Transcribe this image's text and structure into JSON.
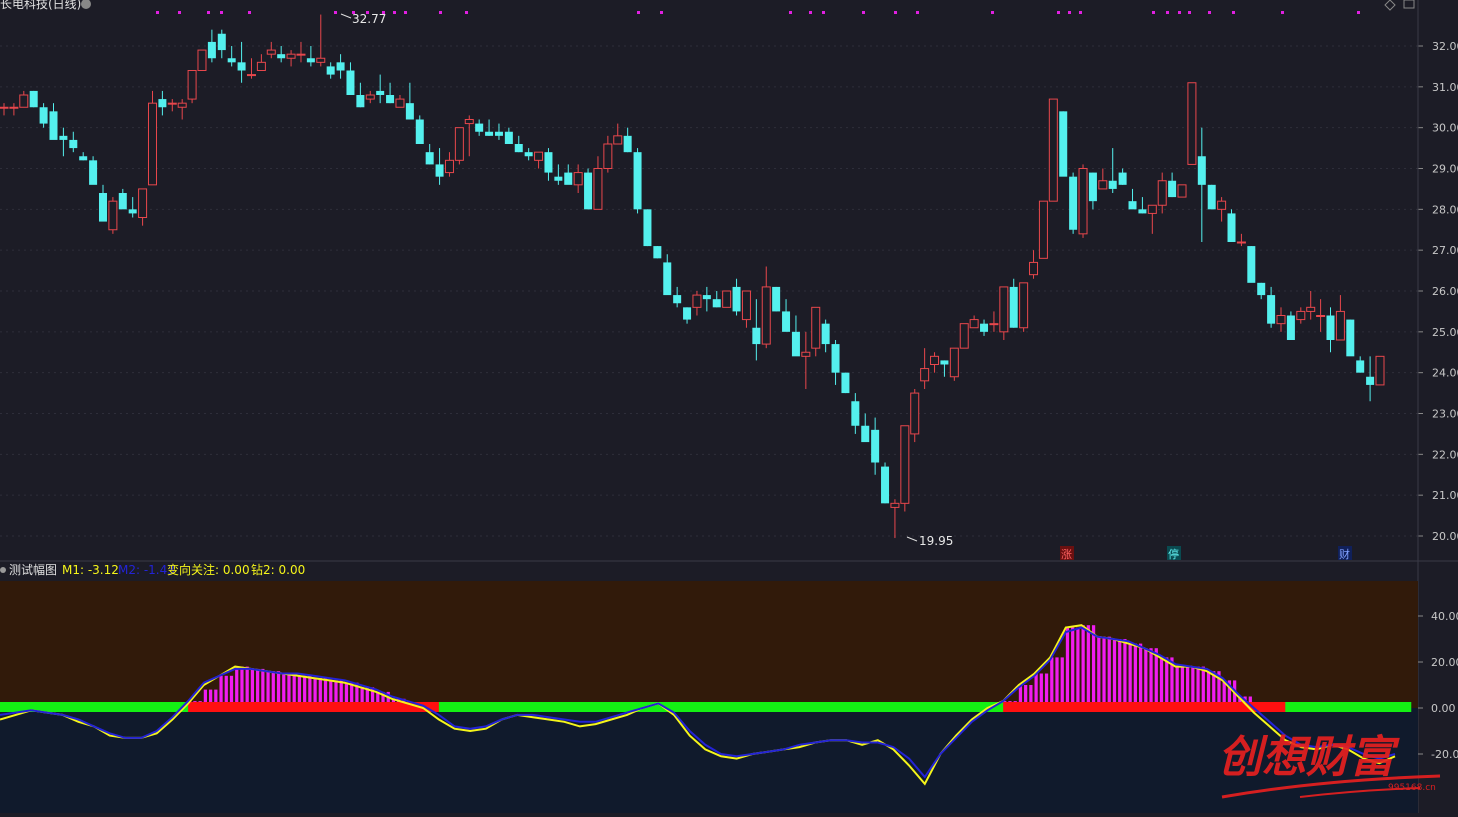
{
  "header": {
    "stock_title": "长电科技(日线)",
    "settings_glyph": "⚙",
    "corner_icon": "diamond-icon"
  },
  "indicator_header": {
    "title": "测试幅图",
    "m1_label": "M1: -3.12",
    "m2_label": "M2: -1.43",
    "watch_label": "变向关注: 0.00",
    "drill_label": "钻2: 0.00"
  },
  "annotations": {
    "high_label": "32.77",
    "low_label": "19.95",
    "tags": [
      "涨",
      "停",
      "财"
    ]
  },
  "watermark": {
    "text": "创想财富",
    "url": "995168.cn"
  },
  "colors": {
    "background": "#1c1c26",
    "up_candle": "#e8474c",
    "down_candle": "#54f0ee",
    "m1_line": "#f5f51a",
    "m2_line": "#2323d6",
    "hist_bar": "#f01cf0",
    "green_band": "#14f014",
    "red_band": "#ff1010",
    "upper_zone": "#311a0a",
    "lower_zone": "#101a2c",
    "axis_text": "#c8c8c8",
    "watermark": "#e62020"
  },
  "chart_data": [
    {
      "type": "candlestick",
      "y_ticks": [
        "32.00",
        "31.00",
        "30.00",
        "29.00",
        "28.00",
        "27.00",
        "26.00",
        "25.00",
        "24.00",
        "23.00",
        "22.00",
        "21.00",
        "20.00"
      ],
      "ylim": [
        19.6,
        32.9
      ],
      "grid": true,
      "highest": 32.77,
      "lowest": 19.95,
      "ohlc": [
        [
          30.5,
          30.6,
          30.3,
          30.5
        ],
        [
          30.5,
          30.6,
          30.3,
          30.5
        ],
        [
          30.5,
          30.9,
          30.5,
          30.8
        ],
        [
          30.9,
          30.9,
          30.5,
          30.5
        ],
        [
          30.5,
          30.6,
          30.0,
          30.1
        ],
        [
          30.4,
          30.6,
          29.8,
          29.7
        ],
        [
          29.8,
          30.0,
          29.3,
          29.7
        ],
        [
          29.7,
          29.9,
          29.4,
          29.5
        ],
        [
          29.3,
          29.4,
          29.2,
          29.2
        ],
        [
          29.2,
          29.3,
          28.7,
          28.6
        ],
        [
          28.4,
          28.6,
          28.0,
          27.7
        ],
        [
          27.5,
          28.3,
          27.4,
          28.2
        ],
        [
          28.4,
          28.5,
          28.2,
          28.0
        ],
        [
          28.0,
          28.3,
          27.8,
          27.9
        ],
        [
          27.8,
          28.5,
          27.6,
          28.5
        ],
        [
          28.6,
          30.9,
          28.6,
          30.6
        ],
        [
          30.7,
          30.9,
          30.3,
          30.5
        ],
        [
          30.6,
          30.7,
          30.4,
          30.6
        ],
        [
          30.5,
          30.7,
          30.2,
          30.6
        ],
        [
          30.7,
          31.4,
          30.6,
          31.4
        ],
        [
          31.4,
          31.9,
          31.4,
          31.9
        ],
        [
          32.1,
          32.4,
          31.6,
          31.7
        ],
        [
          32.3,
          32.4,
          31.7,
          31.9
        ],
        [
          31.7,
          32.0,
          31.5,
          31.6
        ],
        [
          31.6,
          32.1,
          31.1,
          31.4
        ],
        [
          31.3,
          31.7,
          31.2,
          31.3
        ],
        [
          31.4,
          31.8,
          31.4,
          31.6
        ],
        [
          31.8,
          32.1,
          31.7,
          31.9
        ],
        [
          31.8,
          32.0,
          31.6,
          31.7
        ],
        [
          31.7,
          31.9,
          31.5,
          31.8
        ],
        [
          31.8,
          32.1,
          31.6,
          31.8
        ],
        [
          31.7,
          32.0,
          31.5,
          31.6
        ],
        [
          31.6,
          32.77,
          31.5,
          31.7
        ],
        [
          31.5,
          31.6,
          31.2,
          31.3
        ],
        [
          31.6,
          31.8,
          31.2,
          31.4
        ],
        [
          31.4,
          31.6,
          30.8,
          30.8
        ],
        [
          30.8,
          31.1,
          30.5,
          30.5
        ],
        [
          30.7,
          30.9,
          30.6,
          30.8
        ],
        [
          30.9,
          31.3,
          30.6,
          30.8
        ],
        [
          30.8,
          31.1,
          30.6,
          30.6
        ],
        [
          30.5,
          30.8,
          30.5,
          30.7
        ],
        [
          30.6,
          31.1,
          30.5,
          30.2
        ],
        [
          30.2,
          30.3,
          29.6,
          29.6
        ],
        [
          29.4,
          29.6,
          29.1,
          29.1
        ],
        [
          29.1,
          29.5,
          28.6,
          28.8
        ],
        [
          28.9,
          29.4,
          28.8,
          29.2
        ],
        [
          29.2,
          30.0,
          29.1,
          30.0
        ],
        [
          30.1,
          30.3,
          29.3,
          30.2
        ],
        [
          30.1,
          30.2,
          29.8,
          29.9
        ],
        [
          29.9,
          30.2,
          29.8,
          29.8
        ],
        [
          29.9,
          30.1,
          29.7,
          29.8
        ],
        [
          29.9,
          30.0,
          29.6,
          29.6
        ],
        [
          29.6,
          29.8,
          29.4,
          29.4
        ],
        [
          29.4,
          29.5,
          29.2,
          29.3
        ],
        [
          29.2,
          29.3,
          29.0,
          29.4
        ],
        [
          29.4,
          29.5,
          28.7,
          28.9
        ],
        [
          28.8,
          29.1,
          28.6,
          28.7
        ],
        [
          28.9,
          29.1,
          28.8,
          28.6
        ],
        [
          28.6,
          29.1,
          28.4,
          28.9
        ],
        [
          28.9,
          29.0,
          28.0,
          28.0
        ],
        [
          28.0,
          29.3,
          28.0,
          29.0
        ],
        [
          29.0,
          29.8,
          28.9,
          29.6
        ],
        [
          29.6,
          30.1,
          29.6,
          29.8
        ],
        [
          29.8,
          30.0,
          29.4,
          29.4
        ],
        [
          29.4,
          29.5,
          27.9,
          28.0
        ],
        [
          28.0,
          28.0,
          27.1,
          27.1
        ],
        [
          27.1,
          27.1,
          26.8,
          26.8
        ],
        [
          26.7,
          26.9,
          26.0,
          25.9
        ],
        [
          25.9,
          26.1,
          25.6,
          25.7
        ],
        [
          25.6,
          25.6,
          25.2,
          25.3
        ],
        [
          25.6,
          26.0,
          25.4,
          25.9
        ],
        [
          25.9,
          26.1,
          25.5,
          25.8
        ],
        [
          25.8,
          26.0,
          25.6,
          25.6
        ],
        [
          25.6,
          26.0,
          25.7,
          26.0
        ],
        [
          26.1,
          26.3,
          25.4,
          25.5
        ],
        [
          25.3,
          25.7,
          25.1,
          26.0
        ],
        [
          25.1,
          25.8,
          24.3,
          24.7
        ],
        [
          24.7,
          26.6,
          24.6,
          26.1
        ],
        [
          26.1,
          26.1,
          25.5,
          25.5
        ],
        [
          25.5,
          25.8,
          25.3,
          25.0
        ],
        [
          25.0,
          25.4,
          24.6,
          24.4
        ],
        [
          24.4,
          25.0,
          23.6,
          24.5
        ],
        [
          24.6,
          25.6,
          24.4,
          25.6
        ],
        [
          25.2,
          25.3,
          24.5,
          24.7
        ],
        [
          24.7,
          24.8,
          23.7,
          24.0
        ],
        [
          24.0,
          24.0,
          23.5,
          23.5
        ],
        [
          23.3,
          23.5,
          22.5,
          22.7
        ],
        [
          22.7,
          23.0,
          22.4,
          22.3
        ],
        [
          22.6,
          22.9,
          21.5,
          21.8
        ],
        [
          21.7,
          21.8,
          20.8,
          20.8
        ],
        [
          20.7,
          20.9,
          19.95,
          20.8
        ],
        [
          20.8,
          22.7,
          20.6,
          22.7
        ],
        [
          22.5,
          23.6,
          22.3,
          23.5
        ],
        [
          23.8,
          24.6,
          23.6,
          24.1
        ],
        [
          24.2,
          24.5,
          24.0,
          24.4
        ],
        [
          24.3,
          24.3,
          23.9,
          24.2
        ],
        [
          23.9,
          24.4,
          23.8,
          24.6
        ],
        [
          24.6,
          25.1,
          24.6,
          25.2
        ],
        [
          25.1,
          25.4,
          25.1,
          25.3
        ],
        [
          25.2,
          25.3,
          24.9,
          25.0
        ],
        [
          25.2,
          25.5,
          25.0,
          25.2
        ],
        [
          25.0,
          26.1,
          24.8,
          26.1
        ],
        [
          26.1,
          26.3,
          25.1,
          25.1
        ],
        [
          25.1,
          26.2,
          25.0,
          26.2
        ],
        [
          26.4,
          27.0,
          26.3,
          26.7
        ],
        [
          26.8,
          28.2,
          26.8,
          28.2
        ],
        [
          28.2,
          30.7,
          28.2,
          30.7
        ],
        [
          30.4,
          30.4,
          28.9,
          28.8
        ],
        [
          28.8,
          28.9,
          27.4,
          27.5
        ],
        [
          27.4,
          29.1,
          27.3,
          29.0
        ],
        [
          28.9,
          28.9,
          28.0,
          28.2
        ],
        [
          28.5,
          29.0,
          28.5,
          28.7
        ],
        [
          28.7,
          29.5,
          28.4,
          28.5
        ],
        [
          28.9,
          29.0,
          28.6,
          28.6
        ],
        [
          28.2,
          28.5,
          28.1,
          28.0
        ],
        [
          28.0,
          28.3,
          27.9,
          27.9
        ],
        [
          27.9,
          28.1,
          27.4,
          28.1
        ],
        [
          28.1,
          28.9,
          27.9,
          28.7
        ],
        [
          28.7,
          28.9,
          28.3,
          28.3
        ],
        [
          28.3,
          28.6,
          28.3,
          28.6
        ],
        [
          29.1,
          31.1,
          29.1,
          31.1
        ],
        [
          29.3,
          30.0,
          27.2,
          28.6
        ],
        [
          28.6,
          28.6,
          28.0,
          28.0
        ],
        [
          28.0,
          28.3,
          27.7,
          28.2
        ],
        [
          27.9,
          28.0,
          27.2,
          27.2
        ],
        [
          27.2,
          27.4,
          27.1,
          27.2
        ],
        [
          27.1,
          27.1,
          26.3,
          26.2
        ],
        [
          26.2,
          26.2,
          25.8,
          25.9
        ],
        [
          25.9,
          26.1,
          25.1,
          25.2
        ],
        [
          25.2,
          25.6,
          25.0,
          25.4
        ],
        [
          25.4,
          25.5,
          24.8,
          24.8
        ],
        [
          25.3,
          25.6,
          25.2,
          25.5
        ],
        [
          25.5,
          26.0,
          25.3,
          25.6
        ],
        [
          25.4,
          25.8,
          25.0,
          25.4
        ],
        [
          25.4,
          25.6,
          24.5,
          24.8
        ],
        [
          24.8,
          25.9,
          24.8,
          25.5
        ],
        [
          25.3,
          25.3,
          24.6,
          24.4
        ],
        [
          24.3,
          24.4,
          24.0,
          24.0
        ],
        [
          23.9,
          24.4,
          23.3,
          23.7
        ],
        [
          23.7,
          24.3,
          23.7,
          24.4
        ]
      ]
    },
    {
      "type": "line",
      "title": "测试幅图",
      "y_ticks": [
        "40.00",
        "20.00",
        "0.00",
        "-20.00"
      ],
      "ylim": [
        -45,
        55
      ],
      "grid": false,
      "series": [
        {
          "name": "M1",
          "values": [
            -5,
            -3,
            -1,
            -2,
            -3,
            -6,
            -8,
            -12,
            -13,
            -13,
            -11,
            -5,
            2,
            10,
            14,
            18,
            17,
            16,
            15,
            14,
            13,
            12,
            11,
            9,
            7,
            4,
            2,
            0,
            -5,
            -9,
            -10,
            -9,
            -5,
            -3,
            -4,
            -5,
            -6,
            -8,
            -7,
            -5,
            -3,
            0,
            2,
            -3,
            -12,
            -18,
            -21,
            -22,
            -20,
            -19,
            -18,
            -17,
            -15,
            -14,
            -14,
            -16,
            -14,
            -18,
            -25,
            -33,
            -20,
            -12,
            -5,
            0,
            3,
            10,
            15,
            22,
            35,
            36,
            31,
            30,
            28,
            26,
            22,
            18,
            18,
            16,
            12,
            5,
            -2,
            -8,
            -14,
            -17,
            -18,
            -16,
            -18,
            -22,
            -24,
            -21
          ]
        },
        {
          "name": "M2",
          "values": [
            -3,
            -2,
            -1,
            -2,
            -3,
            -5,
            -8,
            -11,
            -13,
            -13,
            -10,
            -4,
            3,
            11,
            14,
            17,
            17,
            16,
            15,
            15,
            14,
            13,
            12,
            10,
            8,
            5,
            3,
            1,
            -3,
            -8,
            -9,
            -8,
            -5,
            -3,
            -3,
            -4,
            -5,
            -6,
            -6,
            -4,
            -2,
            0,
            2,
            -2,
            -10,
            -16,
            -20,
            -21,
            -20,
            -19,
            -18,
            -16,
            -15,
            -14,
            -14,
            -15,
            -15,
            -17,
            -22,
            -30,
            -20,
            -13,
            -6,
            -1,
            3,
            9,
            14,
            21,
            33,
            35,
            31,
            30,
            29,
            26,
            23,
            19,
            18,
            17,
            13,
            6,
            0,
            -6,
            -12,
            -16,
            -17,
            -16,
            -17,
            -20,
            -22,
            -20
          ]
        }
      ],
      "histogram": [
        0,
        0,
        0,
        0,
        0,
        0,
        0,
        0,
        0,
        0,
        0,
        0,
        3,
        8,
        14,
        18,
        17,
        16,
        15,
        14,
        13,
        12,
        11,
        9,
        7,
        4,
        2,
        0,
        0,
        0,
        0,
        0,
        0,
        0,
        0,
        0,
        0,
        0,
        0,
        0,
        0,
        0,
        0,
        0,
        0,
        0,
        0,
        0,
        0,
        0,
        0,
        0,
        0,
        0,
        0,
        0,
        0,
        0,
        0,
        0,
        0,
        0,
        0,
        0,
        3,
        10,
        15,
        22,
        35,
        36,
        31,
        30,
        28,
        26,
        22,
        18,
        18,
        16,
        12,
        5,
        0,
        0,
        0,
        0,
        0,
        0,
        0,
        0,
        0,
        0
      ],
      "state_band": [
        "green",
        "green",
        "green",
        "green",
        "green",
        "green",
        "green",
        "green",
        "green",
        "green",
        "green",
        "green",
        "red",
        "red",
        "red",
        "red",
        "red",
        "red",
        "red",
        "red",
        "red",
        "red",
        "red",
        "red",
        "red",
        "red",
        "red",
        "red",
        "green",
        "green",
        "green",
        "green",
        "green",
        "green",
        "green",
        "green",
        "green",
        "green",
        "green",
        "green",
        "green",
        "green",
        "green",
        "green",
        "green",
        "green",
        "green",
        "green",
        "green",
        "green",
        "green",
        "green",
        "green",
        "green",
        "green",
        "green",
        "green",
        "green",
        "green",
        "green",
        "green",
        "green",
        "green",
        "green",
        "red",
        "red",
        "red",
        "red",
        "red",
        "red",
        "red",
        "red",
        "red",
        "red",
        "red",
        "red",
        "red",
        "red",
        "red",
        "red",
        "red",
        "red",
        "green",
        "green",
        "green",
        "green",
        "green",
        "green",
        "green",
        "green"
      ]
    }
  ]
}
